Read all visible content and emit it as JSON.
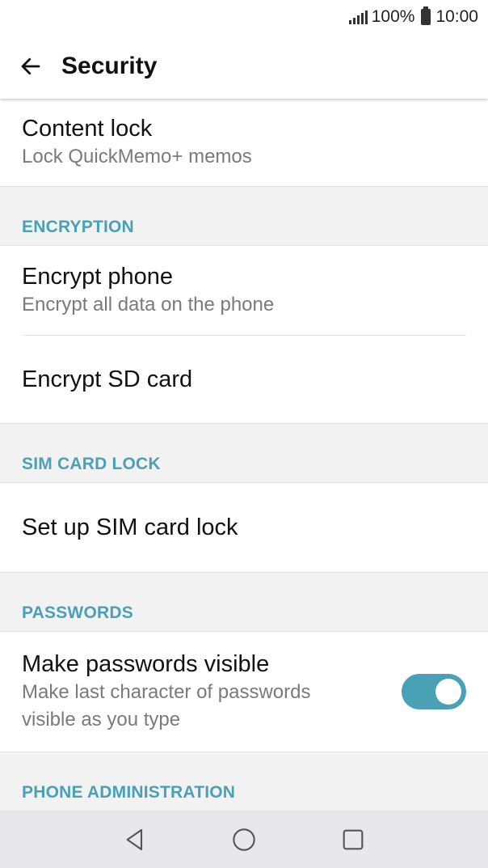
{
  "status_bar": {
    "battery": "100%",
    "time": "10:00"
  },
  "app_bar": {
    "title": "Security"
  },
  "items": {
    "content_lock": {
      "title": "Content lock",
      "subtitle": "Lock QuickMemo+ memos"
    },
    "encrypt_phone": {
      "title": "Encrypt phone",
      "subtitle": "Encrypt all data on the phone"
    },
    "encrypt_sd": {
      "title": "Encrypt SD card"
    },
    "sim_lock": {
      "title": "Set up SIM card lock"
    },
    "passwords_visible": {
      "title": "Make passwords visible",
      "subtitle": "Make last character of passwords visible as you type",
      "enabled": true
    }
  },
  "sections": {
    "encryption": "ENCRYPTION",
    "sim_card_lock": "SIM CARD LOCK",
    "passwords": "PASSWORDS",
    "phone_admin": "PHONE ADMINISTRATION"
  },
  "colors": {
    "accent": "#4aa0b5",
    "section_bg": "#f2f2f2",
    "nav_bg": "#e8e8ea"
  },
  "icons": {
    "back": "arrow-left-icon",
    "nav_back": "triangle-back-icon",
    "nav_home": "circle-home-icon",
    "nav_recents": "square-recents-icon"
  }
}
